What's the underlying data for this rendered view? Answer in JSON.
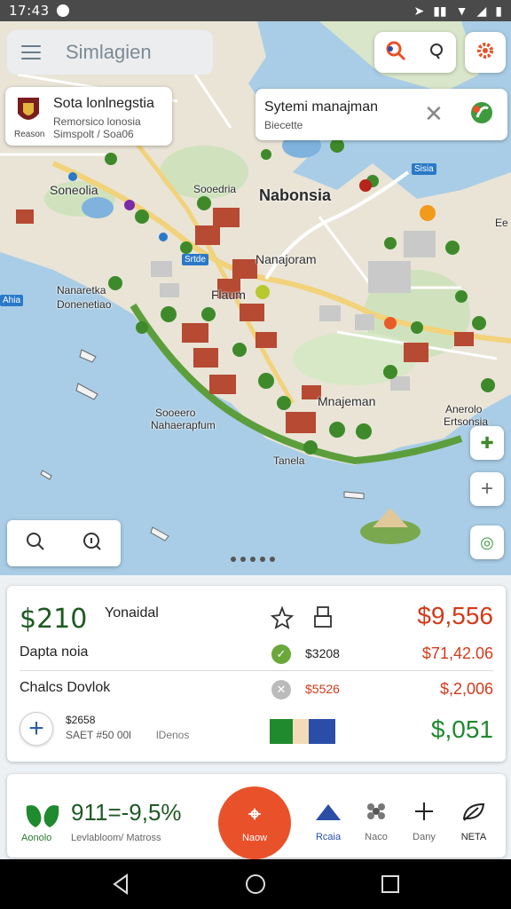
{
  "status_bar": {
    "time": "17:43"
  },
  "header": {
    "title": "Simlagien"
  },
  "info_card_left": {
    "title": "Sota lonlnegstia",
    "line1": "Remorsico lonosia",
    "line2": "Simspolt / Soa06",
    "caption": "Reason"
  },
  "info_card_right": {
    "title": "Sytemi manajman",
    "subtitle": "Biecette"
  },
  "map_labels": {
    "soneolio": "Soneolia",
    "sooedria": "Sooedria",
    "nabosia": "Nabonsia",
    "nanajoram": "Nanajoram",
    "flaum": "Flaum",
    "nanareka": "Nanaretka",
    "donenetao": "Donenetiao",
    "manajman": "Mnajeman",
    "sooeero": "Sooeero",
    "narerapora": "Nahaerapfum",
    "tanela": "Tanela",
    "anerolo": "Anerolo",
    "right_label": "Ertsonsia",
    "edge": "Ee",
    "sign1": "Sisia",
    "sign2": "Srtde",
    "sign3": "Ahia"
  },
  "finance": {
    "big_value": "$210",
    "big_label": "Yonaidal",
    "total": "$9,556",
    "row1_label": "Dapta noia",
    "row1_mid": "$3208",
    "row1_right": "$71,42.06",
    "row2_label": "Chalcs Dovlok",
    "row2_mid": "$5526",
    "row2_right": "$,2,006",
    "small1": "$2658",
    "small2": "SAET #50 00l",
    "small3": "lDenos",
    "final": "$,051",
    "bar_colors": [
      "#1f8a2e",
      "#f2dcb8",
      "#2a4ea8"
    ]
  },
  "bottom_bar": {
    "logo_label": "Aonolo",
    "stat": "911=-9,5%",
    "stat_label": "Levlabloom/ Matross",
    "fab_label": "Naow",
    "nav": [
      {
        "label": "Rcaia",
        "icon": "triangle-icon"
      },
      {
        "label": "Naco",
        "icon": "flower-icon"
      },
      {
        "label": "Dany",
        "icon": "plus-icon"
      },
      {
        "label": "NETA",
        "icon": "leaf-icon"
      }
    ]
  }
}
